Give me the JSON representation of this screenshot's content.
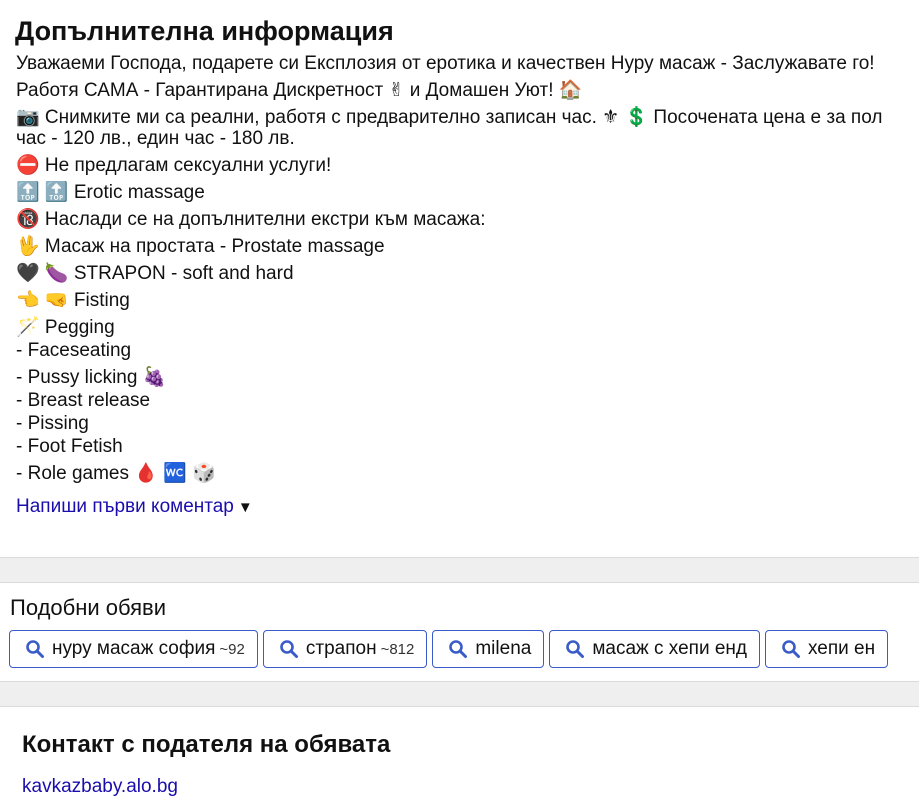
{
  "info": {
    "title": "Допълнителна информация",
    "lines": [
      "Уважаеми Господа, подарете си Експлозия от еротика и качествен Нуру масаж - Заслужавате го!",
      "Работя САМА - Гарантирана Дискретност ✌ и Домашен Уют! 🏠",
      "📷 Снимките ми са реални, работя с предварително записан час. ⚜ 💲 Посочената цена е за пол",
      "час - 120 лв., един час - 180 лв.",
      "⛔ Не предлагам сексуални услуги!",
      "🔝 🔝 Erotic massage",
      "🔞 Наслади се на допълнителни екстри към масажа:",
      "🖖 Масаж на простата - Prostate massage",
      "🖤 🍆 STRAPON - soft and hard",
      "👈 🤜 Fisting",
      "🪄 Pegging",
      "- Faceseating",
      "- Pussy licking 🍇",
      "- Breast release",
      "- Pissing",
      "- Foot Fetish",
      "- Role games 🩸 🚾 🎲"
    ],
    "comment_link": "Напиши първи коментар",
    "comment_arrow": "▼"
  },
  "similar": {
    "title": "Подобни обяви",
    "tags": [
      {
        "label": "нуру масаж софия",
        "count": "~92"
      },
      {
        "label": "страпон",
        "count": "~812"
      },
      {
        "label": "milena",
        "count": ""
      },
      {
        "label": "масаж с хепи енд",
        "count": ""
      },
      {
        "label": "хепи ен",
        "count": ""
      }
    ]
  },
  "contact": {
    "title": "Контакт с подателя на обявата",
    "link": "kavkazbaby.alo.bg"
  },
  "colors": {
    "link": "#1a0dab",
    "tag_border": "#3a5cc9",
    "band": "#efefef"
  }
}
